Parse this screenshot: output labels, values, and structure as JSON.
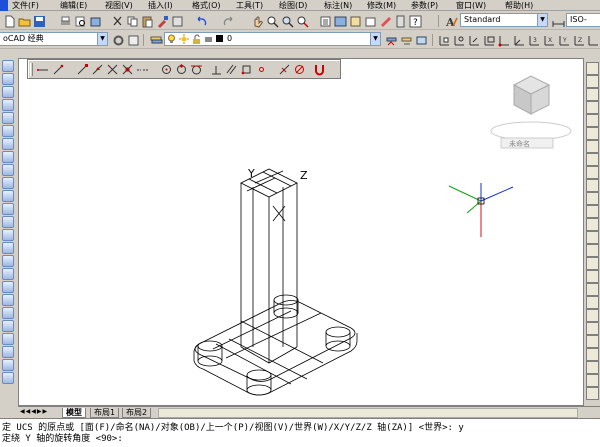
{
  "menu": [
    "文件(F)",
    "编辑(E)",
    "视图(V)",
    "插入(I)",
    "格式(O)",
    "工具(T)",
    "绘图(D)",
    "标注(N)",
    "修改(M)",
    "参数(P)",
    "窗口(W)",
    "帮助(H)"
  ],
  "toolbar": {
    "workspace": "oCAD 经典",
    "layer_value": "0",
    "style_value": "Standard",
    "dimstyle_value": "ISO-"
  },
  "viewcube": {
    "bottom_label": "未命名"
  },
  "drawing": {
    "axis_y": "Y",
    "axis_z": "Z"
  },
  "tabs": [
    "模型",
    "布局1",
    "布局2"
  ],
  "command": {
    "line1": "定 UCS 的原点或 [面(F)/命名(NA)/对象(OB)/上一个(P)/视图(V)/世界(W)/X/Y/Z/Z 轴(ZA)] <世界>: y",
    "line2": "定绕 Y 轴的旋转角度 <90>:"
  },
  "icons": {
    "accent": "#1e4fd8",
    "axis_red": "#d01010",
    "axis_green": "#10a010",
    "axis_blue": "#1030d0"
  }
}
